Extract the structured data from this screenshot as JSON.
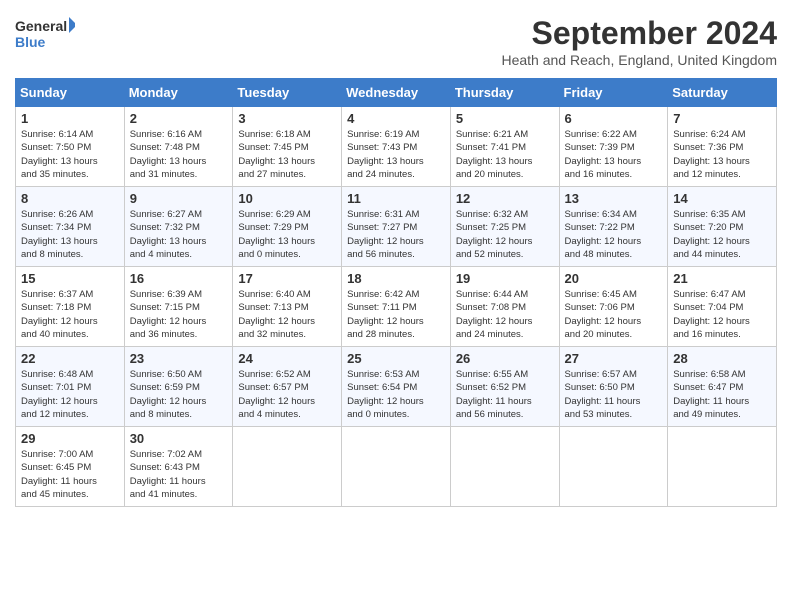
{
  "header": {
    "logo_line1": "General",
    "logo_line2": "Blue",
    "month_title": "September 2024",
    "location": "Heath and Reach, England, United Kingdom"
  },
  "days_of_week": [
    "Sunday",
    "Monday",
    "Tuesday",
    "Wednesday",
    "Thursday",
    "Friday",
    "Saturday"
  ],
  "weeks": [
    [
      {
        "day": "1",
        "info": "Sunrise: 6:14 AM\nSunset: 7:50 PM\nDaylight: 13 hours\nand 35 minutes."
      },
      {
        "day": "2",
        "info": "Sunrise: 6:16 AM\nSunset: 7:48 PM\nDaylight: 13 hours\nand 31 minutes."
      },
      {
        "day": "3",
        "info": "Sunrise: 6:18 AM\nSunset: 7:45 PM\nDaylight: 13 hours\nand 27 minutes."
      },
      {
        "day": "4",
        "info": "Sunrise: 6:19 AM\nSunset: 7:43 PM\nDaylight: 13 hours\nand 24 minutes."
      },
      {
        "day": "5",
        "info": "Sunrise: 6:21 AM\nSunset: 7:41 PM\nDaylight: 13 hours\nand 20 minutes."
      },
      {
        "day": "6",
        "info": "Sunrise: 6:22 AM\nSunset: 7:39 PM\nDaylight: 13 hours\nand 16 minutes."
      },
      {
        "day": "7",
        "info": "Sunrise: 6:24 AM\nSunset: 7:36 PM\nDaylight: 13 hours\nand 12 minutes."
      }
    ],
    [
      {
        "day": "8",
        "info": "Sunrise: 6:26 AM\nSunset: 7:34 PM\nDaylight: 13 hours\nand 8 minutes."
      },
      {
        "day": "9",
        "info": "Sunrise: 6:27 AM\nSunset: 7:32 PM\nDaylight: 13 hours\nand 4 minutes."
      },
      {
        "day": "10",
        "info": "Sunrise: 6:29 AM\nSunset: 7:29 PM\nDaylight: 13 hours\nand 0 minutes."
      },
      {
        "day": "11",
        "info": "Sunrise: 6:31 AM\nSunset: 7:27 PM\nDaylight: 12 hours\nand 56 minutes."
      },
      {
        "day": "12",
        "info": "Sunrise: 6:32 AM\nSunset: 7:25 PM\nDaylight: 12 hours\nand 52 minutes."
      },
      {
        "day": "13",
        "info": "Sunrise: 6:34 AM\nSunset: 7:22 PM\nDaylight: 12 hours\nand 48 minutes."
      },
      {
        "day": "14",
        "info": "Sunrise: 6:35 AM\nSunset: 7:20 PM\nDaylight: 12 hours\nand 44 minutes."
      }
    ],
    [
      {
        "day": "15",
        "info": "Sunrise: 6:37 AM\nSunset: 7:18 PM\nDaylight: 12 hours\nand 40 minutes."
      },
      {
        "day": "16",
        "info": "Sunrise: 6:39 AM\nSunset: 7:15 PM\nDaylight: 12 hours\nand 36 minutes."
      },
      {
        "day": "17",
        "info": "Sunrise: 6:40 AM\nSunset: 7:13 PM\nDaylight: 12 hours\nand 32 minutes."
      },
      {
        "day": "18",
        "info": "Sunrise: 6:42 AM\nSunset: 7:11 PM\nDaylight: 12 hours\nand 28 minutes."
      },
      {
        "day": "19",
        "info": "Sunrise: 6:44 AM\nSunset: 7:08 PM\nDaylight: 12 hours\nand 24 minutes."
      },
      {
        "day": "20",
        "info": "Sunrise: 6:45 AM\nSunset: 7:06 PM\nDaylight: 12 hours\nand 20 minutes."
      },
      {
        "day": "21",
        "info": "Sunrise: 6:47 AM\nSunset: 7:04 PM\nDaylight: 12 hours\nand 16 minutes."
      }
    ],
    [
      {
        "day": "22",
        "info": "Sunrise: 6:48 AM\nSunset: 7:01 PM\nDaylight: 12 hours\nand 12 minutes."
      },
      {
        "day": "23",
        "info": "Sunrise: 6:50 AM\nSunset: 6:59 PM\nDaylight: 12 hours\nand 8 minutes."
      },
      {
        "day": "24",
        "info": "Sunrise: 6:52 AM\nSunset: 6:57 PM\nDaylight: 12 hours\nand 4 minutes."
      },
      {
        "day": "25",
        "info": "Sunrise: 6:53 AM\nSunset: 6:54 PM\nDaylight: 12 hours\nand 0 minutes."
      },
      {
        "day": "26",
        "info": "Sunrise: 6:55 AM\nSunset: 6:52 PM\nDaylight: 11 hours\nand 56 minutes."
      },
      {
        "day": "27",
        "info": "Sunrise: 6:57 AM\nSunset: 6:50 PM\nDaylight: 11 hours\nand 53 minutes."
      },
      {
        "day": "28",
        "info": "Sunrise: 6:58 AM\nSunset: 6:47 PM\nDaylight: 11 hours\nand 49 minutes."
      }
    ],
    [
      {
        "day": "29",
        "info": "Sunrise: 7:00 AM\nSunset: 6:45 PM\nDaylight: 11 hours\nand 45 minutes."
      },
      {
        "day": "30",
        "info": "Sunrise: 7:02 AM\nSunset: 6:43 PM\nDaylight: 11 hours\nand 41 minutes."
      },
      {
        "day": "",
        "info": ""
      },
      {
        "day": "",
        "info": ""
      },
      {
        "day": "",
        "info": ""
      },
      {
        "day": "",
        "info": ""
      },
      {
        "day": "",
        "info": ""
      }
    ]
  ]
}
